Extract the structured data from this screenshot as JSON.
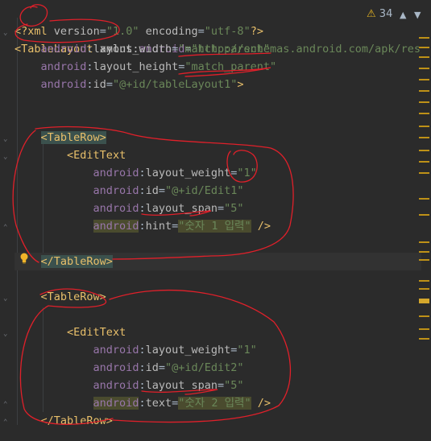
{
  "inspection": {
    "warning_count": "34",
    "up_label": "▲",
    "down_label": "▼"
  },
  "code": {
    "l1": {
      "pi_open": "<?",
      "kw": "xml",
      "a1": "version",
      "v1": "\"1.0\"",
      "a2": "encoding",
      "v2": "\"utf-8\"",
      "pi_close": "?>"
    },
    "l2": {
      "open": "<",
      "tag": "TableLayout",
      "ns": "xmlns",
      "colon": ":",
      "attr": "android",
      "val": "\"http://schemas.android.com/apk/res/an"
    },
    "l3": {
      "ns": "android",
      "attr": "layout_width",
      "val": "\"match_parent\""
    },
    "l4": {
      "ns": "android",
      "attr": "layout_height",
      "val": "\"match_parent\""
    },
    "l5": {
      "ns": "android",
      "attr": "id",
      "val": "\"@+id/tableLayout1\"",
      "close": ">"
    },
    "l8": {
      "text": "<TableRow>"
    },
    "l9": {
      "open": "<",
      "tag": "EditText"
    },
    "l10": {
      "ns": "android",
      "attr": "layout_weight",
      "val": "\"1\""
    },
    "l11": {
      "ns": "android",
      "attr": "id",
      "val": "\"@+id/Edit1\""
    },
    "l12": {
      "ns": "android",
      "attr": "layout_span",
      "val": "\"5\""
    },
    "l13": {
      "ns": "android",
      "attr": "hint",
      "val": "\"숫자 1 입력\"",
      "close": " />"
    },
    "l15": {
      "text": "</TableRow>"
    },
    "l17": {
      "text": "<TableRow>"
    },
    "l19": {
      "open": "<",
      "tag": "EditText"
    },
    "l20": {
      "ns": "android",
      "attr": "layout_weight",
      "val": "\"1\""
    },
    "l21": {
      "ns": "android",
      "attr": "id",
      "val": "\"@+id/Edit2\""
    },
    "l22": {
      "ns": "android",
      "attr": "layout_span",
      "val": "\"5\""
    },
    "l23": {
      "ns": "android",
      "attr": "text",
      "val": "\"숫자 2 입력\"",
      "close": " />"
    },
    "l24": {
      "text": "</TableRow>"
    }
  },
  "colors": {
    "background": "#2b2b2b",
    "tag": "#e8bf6a",
    "namespace": "#9876aa",
    "value": "#6a8759",
    "annotation": "#e0202a",
    "marker": "#be9117"
  },
  "icons": {
    "warning": "warning-triangle-icon",
    "intention": "lightbulb-icon",
    "fold": "fold-arrow-icon"
  }
}
